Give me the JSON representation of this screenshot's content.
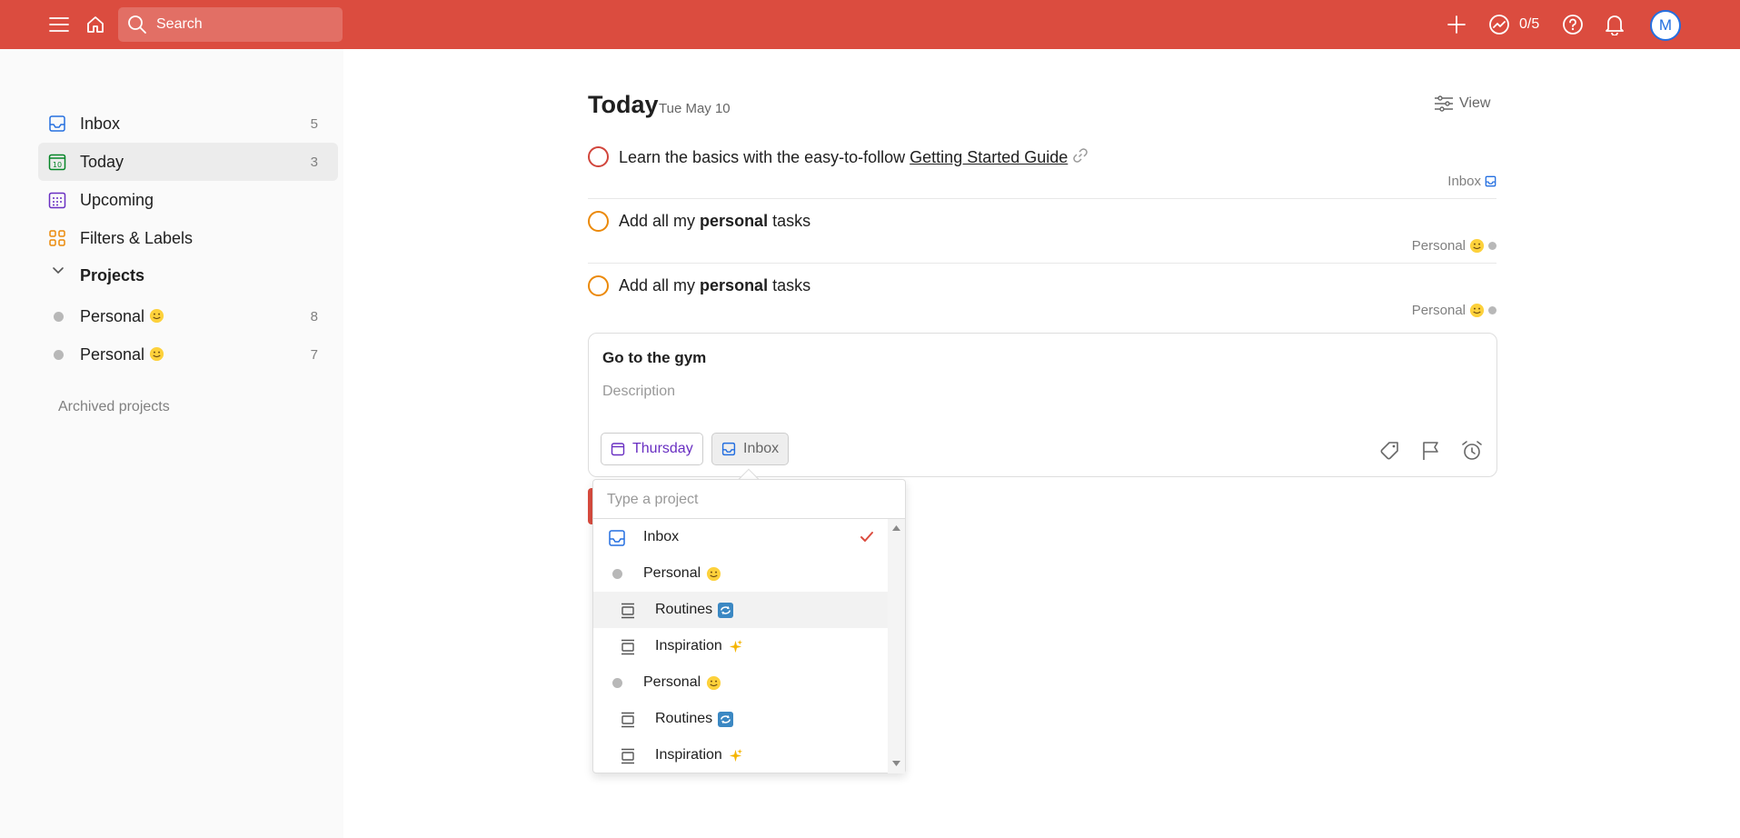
{
  "topbar": {
    "search_placeholder": "Search",
    "karma": "0/5",
    "avatar_initial": "M",
    "colors": {
      "bar": "#db4c3f"
    }
  },
  "sidebar": {
    "items": [
      {
        "label": "Inbox",
        "count": "5"
      },
      {
        "label": "Today",
        "count": "3"
      },
      {
        "label": "Upcoming",
        "count": ""
      },
      {
        "label": "Filters & Labels",
        "count": ""
      }
    ],
    "projects_header": "Projects",
    "projects": [
      {
        "label": "Personal",
        "count": "8"
      },
      {
        "label": "Personal",
        "count": "7"
      }
    ],
    "archived": "Archived projects"
  },
  "main": {
    "title": "Today",
    "date": "Tue May 10",
    "view_label": "View",
    "tasks": [
      {
        "pre": "Learn the basics with the easy-to-follow ",
        "link": "Getting Started Guide",
        "meta": "Inbox"
      },
      {
        "pre": "Add all my ",
        "bold": "personal",
        "post": " tasks",
        "meta": "Personal"
      },
      {
        "pre": "Add all my ",
        "bold": "personal",
        "post": " tasks",
        "meta": "Personal"
      }
    ],
    "editor": {
      "name": "Go to the gym",
      "description_placeholder": "Description",
      "date_chip": "Thursday",
      "project_chip": "Inbox"
    }
  },
  "dropdown": {
    "placeholder": "Type a project",
    "items": [
      {
        "label": "Inbox",
        "type": "inbox",
        "selected": true
      },
      {
        "label": "Personal",
        "type": "project"
      },
      {
        "label": "Routines",
        "type": "section"
      },
      {
        "label": "Inspiration",
        "type": "section"
      },
      {
        "label": "Personal",
        "type": "project"
      },
      {
        "label": "Routines",
        "type": "section"
      },
      {
        "label": "Inspiration",
        "type": "section"
      }
    ]
  }
}
